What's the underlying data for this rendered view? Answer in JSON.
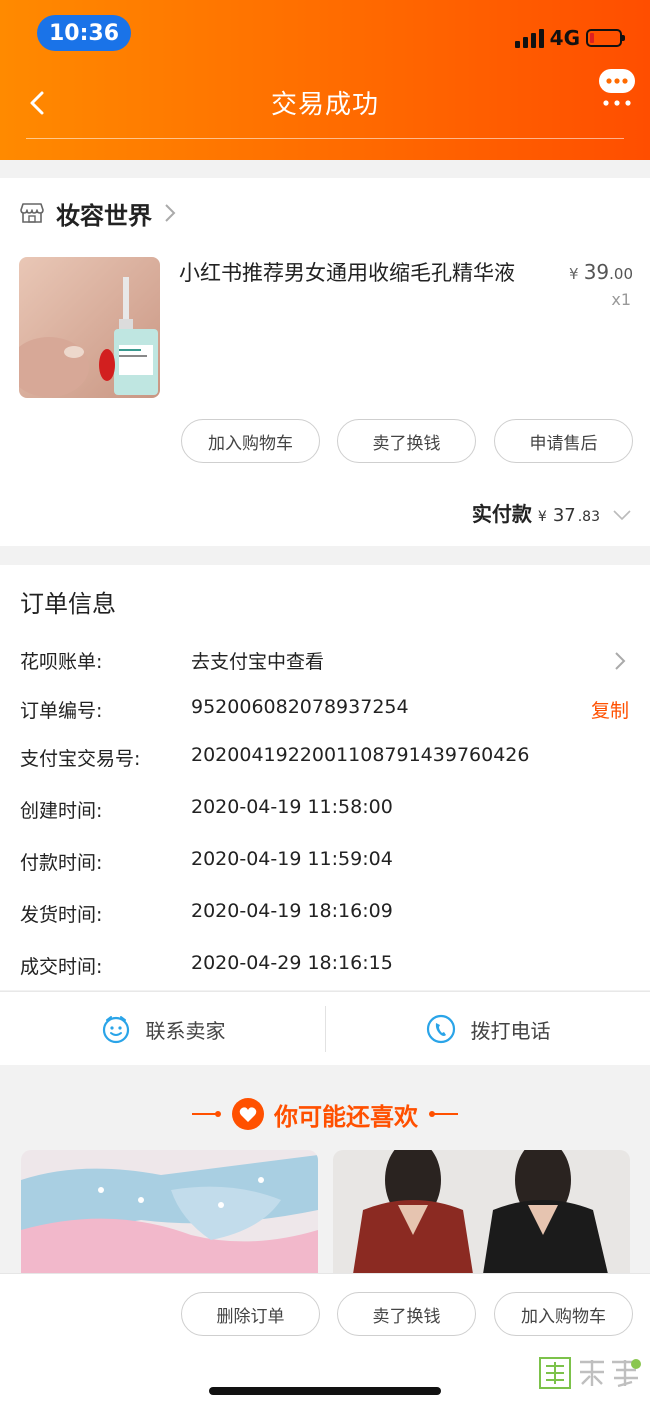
{
  "status_bar": {
    "time": "10:36",
    "network": "4G",
    "battery_level": 0.15
  },
  "header": {
    "title": "交易成功",
    "back_icon": "chevron-left-icon",
    "more_icon": "chat-bubble-more-icon"
  },
  "shop": {
    "name": "妆容世界",
    "icon": "store-icon"
  },
  "product": {
    "title": "小红书推荐男女通用收缩毛孔精华液",
    "currency": "¥",
    "price_int": "39",
    "price_dec": ".00",
    "quantity": "x1"
  },
  "item_actions": [
    {
      "label": "加入购物车"
    },
    {
      "label": "卖了换钱"
    },
    {
      "label": "申请售后"
    }
  ],
  "payment": {
    "label": "实付款",
    "currency": "¥",
    "amount_int": "37",
    "amount_dec": ".83"
  },
  "order_info": {
    "heading": "订单信息",
    "rows": [
      {
        "label": "花呗账单:",
        "value": "去支付宝中查看"
      },
      {
        "label": "订单编号:",
        "value": "952006082078937254",
        "action": "复制"
      },
      {
        "label": "支付宝交易号:",
        "value": "2020041922001108791439760426"
      },
      {
        "label": "创建时间:",
        "value": "2020-04-19 11:58:00"
      },
      {
        "label": "付款时间:",
        "value": "2020-04-19 11:59:04"
      },
      {
        "label": "发货时间:",
        "value": "2020-04-19 18:16:09"
      },
      {
        "label": "成交时间:",
        "value": "2020-04-29 18:16:15"
      }
    ]
  },
  "contact": {
    "seller_label": "联系卖家",
    "phone_label": "拨打电话"
  },
  "recommend": {
    "title": "你可能还喜欢"
  },
  "bottom_actions": [
    {
      "label": "删除订单"
    },
    {
      "label": "卖了换钱"
    },
    {
      "label": "加入购物车"
    }
  ],
  "colors": {
    "accent": "#ff5000",
    "header_start": "#ff8a00",
    "header_end": "#ff4e00"
  }
}
